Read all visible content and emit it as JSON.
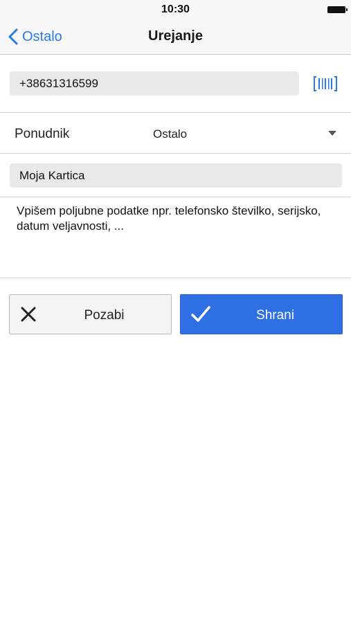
{
  "status_bar": {
    "time": "10:30"
  },
  "nav": {
    "back_label": "Ostalo",
    "title": "Urejanje"
  },
  "card": {
    "number": "+38631316599",
    "provider_label": "Ponudnik",
    "provider_value": "Ostalo",
    "name": "Moja Kartica",
    "notes": "Vpišem poljubne podatke npr. telefonsko številko, serijsko, datum veljavnosti, ..."
  },
  "actions": {
    "forget_label": "Pozabi",
    "save_label": "Shrani"
  },
  "colors": {
    "accent": "#2a7ae4",
    "save_button": "#2f6fe4",
    "input_background": "#e9e9e9"
  },
  "icons": {
    "back": "chevron-left-icon",
    "barcode": "barcode-icon",
    "dropdown": "caret-down-icon",
    "forget": "close-icon",
    "save": "checkmark-icon"
  }
}
